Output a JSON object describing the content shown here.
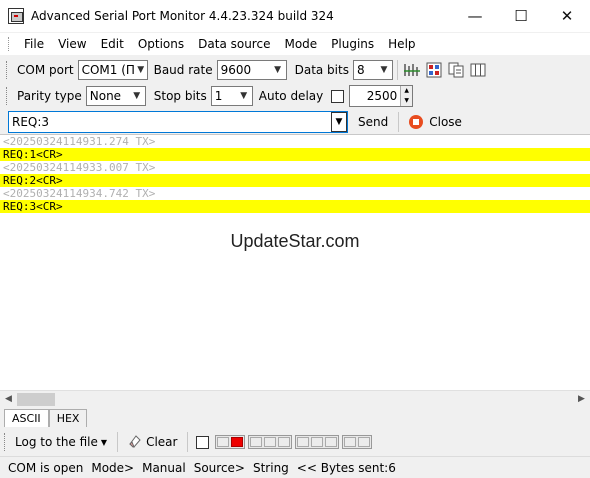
{
  "window": {
    "title": "Advanced Serial Port Monitor 4.4.23.324 build 324",
    "minimize": "—",
    "maximize": "☐",
    "close": "✕"
  },
  "menu": [
    "File",
    "View",
    "Edit",
    "Options",
    "Data source",
    "Mode",
    "Plugins",
    "Help"
  ],
  "toolbar1": {
    "com_port_label": "COM port",
    "com_port_value": "COM1 (П",
    "baud_rate_label": "Baud rate",
    "baud_rate_value": "9600",
    "data_bits_label": "Data bits",
    "data_bits_value": "8"
  },
  "toolbar2": {
    "parity_label": "Parity type",
    "parity_value": "None",
    "stop_bits_label": "Stop bits",
    "stop_bits_value": "1",
    "auto_delay_label": "Auto delay",
    "auto_delay_checked": false,
    "delay_value": "2500"
  },
  "toolbar3": {
    "request_value": "REQ:3",
    "send_label": "Send",
    "close_label": "Close"
  },
  "output_lines": [
    {
      "type": "ts",
      "text": "<20250324114931.274 TX>"
    },
    {
      "type": "data",
      "text": "REQ:1<CR>"
    },
    {
      "type": "ts",
      "text": "<20250324114933.007 TX>"
    },
    {
      "type": "data",
      "text": "REQ:2<CR>"
    },
    {
      "type": "ts",
      "text": "<20250324114934.742 TX>"
    },
    {
      "type": "data",
      "text": "REQ:3<CR>"
    }
  ],
  "watermark": "UpdateStar.com",
  "tabs": [
    "ASCII",
    "HEX"
  ],
  "active_tab": "ASCII",
  "bottom": {
    "log_label": "Log to the file",
    "clear_label": "Clear"
  },
  "status": {
    "port": "COM is open",
    "mode": "Mode>",
    "mode_value": "Manual",
    "source": "Source>",
    "source_value": "String",
    "bytes": "<< Bytes sent:6"
  },
  "colors": {
    "highlight": "#ffff00",
    "timestamp_text": "#b0b0b0",
    "close_icon": "#e84c1f",
    "led_active": "#ee0000"
  }
}
